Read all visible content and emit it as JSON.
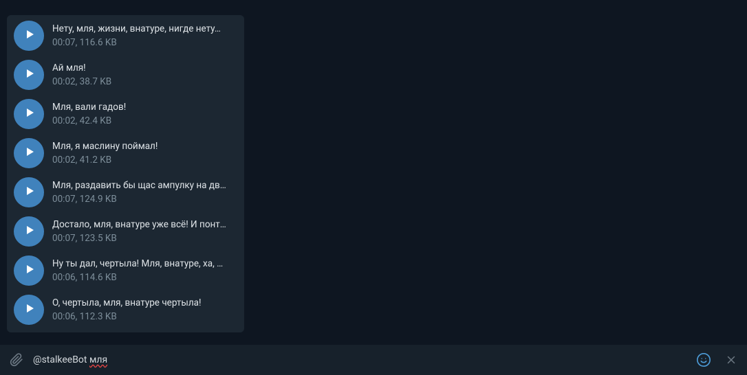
{
  "results": [
    {
      "title": "Нету, мля, жизни, внатуре, нигде нету…",
      "meta": "00:07, 116.6 KB"
    },
    {
      "title": "Ай мля!",
      "meta": "00:02, 38.7 KB"
    },
    {
      "title": "Мля, вали гадов!",
      "meta": "00:02, 42.4 KB"
    },
    {
      "title": "Мля, я маслину поймал!",
      "meta": "00:02, 41.2 KB"
    },
    {
      "title": "Мля, раздавить бы щас ампулку на дв…",
      "meta": "00:07, 124.9 KB"
    },
    {
      "title": "Достало, мля, внатуре уже всё! И понт…",
      "meta": "00:07, 123.5 KB"
    },
    {
      "title": "Ну ты дал, чертыла! Мля, внатуре, ха, …",
      "meta": "00:06, 114.6 KB"
    },
    {
      "title": "О, чертыла, мля, внатуре чертыла!",
      "meta": "00:06, 112.3 KB"
    }
  ],
  "input": {
    "prefix": "@stalkeeBot ",
    "query": "мля"
  }
}
